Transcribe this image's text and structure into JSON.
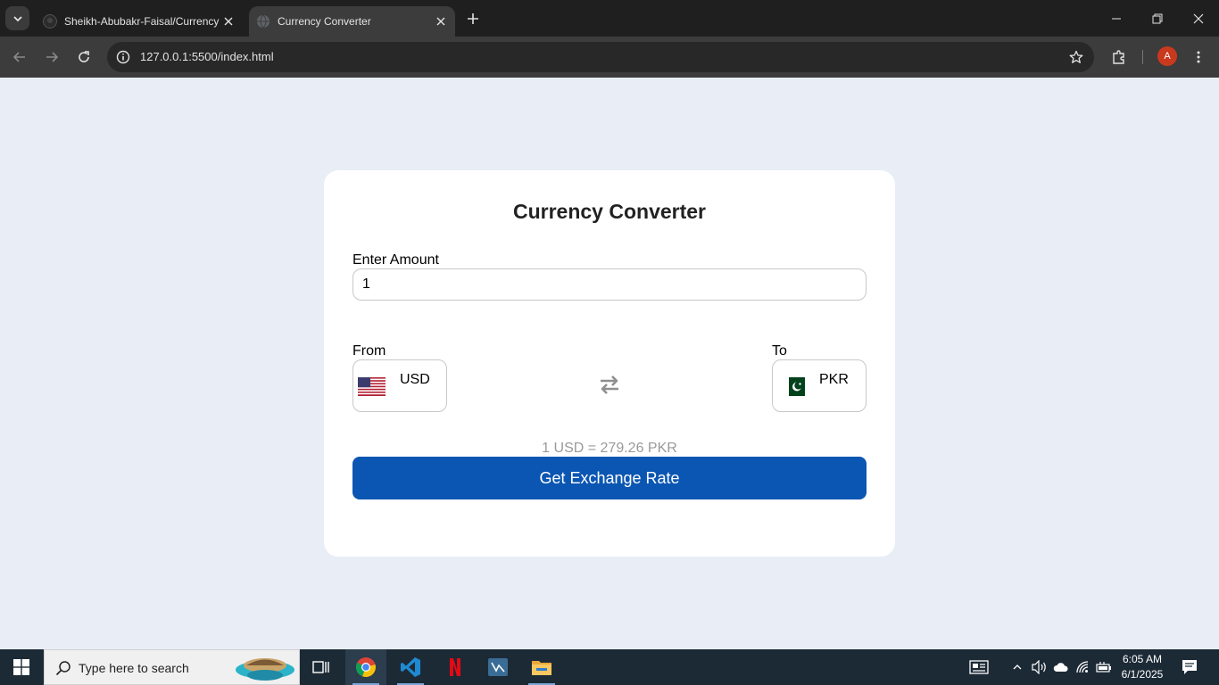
{
  "browser": {
    "tabs": [
      {
        "title": "Sheikh-Abubakr-Faisal/Currency",
        "active": false
      },
      {
        "title": "Currency Converter",
        "active": true
      }
    ],
    "url": "127.0.0.1:5500/index.html",
    "profile_initial": "A"
  },
  "app": {
    "title": "Currency Converter",
    "amount_label": "Enter Amount",
    "amount_value": "1",
    "from_label": "From",
    "from_currency": "USD",
    "to_label": "To",
    "to_currency": "PKR",
    "rate_text": "1 USD = 279.26 PKR",
    "button_label": "Get Exchange Rate"
  },
  "taskbar": {
    "search_placeholder": "Type here to search",
    "time": "6:05 AM",
    "date": "6/1/2025"
  },
  "colors": {
    "page_bg": "#e8edf6",
    "button": "#0b56b2",
    "rate_text": "#9a9a9a"
  }
}
